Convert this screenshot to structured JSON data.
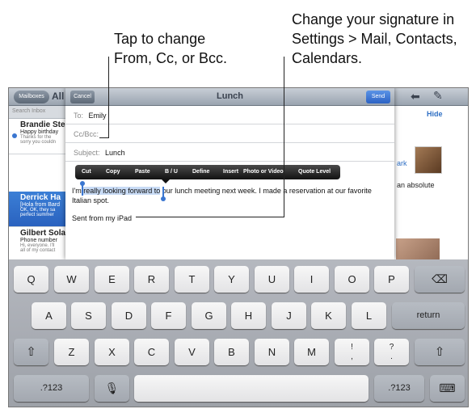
{
  "callouts": {
    "left": [
      "Tap to change",
      "From, Cc, or Bcc."
    ],
    "right": [
      "Change your signature in",
      "Settings > Mail, Contacts,",
      "Calendars."
    ]
  },
  "ipad_bar": {
    "mailboxes_label": "Mailboxes",
    "title": "All I",
    "reply_icon": "reply-arrow-icon",
    "compose_icon": "compose-icon"
  },
  "inbox": {
    "search_placeholder": "Search Inbox",
    "messages": [
      {
        "from": "Brandie Ste",
        "subject": "Happy birthday",
        "preview1": "Thanks for the",
        "preview2": "sorry you couldn"
      },
      {
        "from": "Derrick Ha",
        "subject": "[Hola from Bard",
        "preview1": "OK, OK, they sa",
        "preview2": "perfect summer"
      },
      {
        "from": "Gilbert Sola",
        "subject": "Phone number",
        "preview1": "Hi, everyone. I'll",
        "preview2": "all of my contact"
      }
    ]
  },
  "right_pane": {
    "hide_label": "Hide",
    "link_fragment": "ark",
    "text_fragment": "an absolute"
  },
  "compose": {
    "title": "Lunch",
    "cancel_label": "Cancel",
    "send_label": "Send",
    "to_label": "To:",
    "to_value": "Emily",
    "ccbcc_label": "Cc/Bcc:",
    "subject_label": "Subject:",
    "subject_value": "Lunch",
    "body_before": "I'm ",
    "body_selected": "really looking forward to",
    "body_after": " our lunch meeting next week. I made a reservation at our favorite Italian spot.",
    "signature": "Sent from my iPad"
  },
  "edit_menu": [
    "Cut",
    "Copy",
    "Paste",
    "B / U",
    "Define",
    "Insert",
    "Photo or Video",
    "Quote Level"
  ],
  "keyboard": {
    "row1": [
      "Q",
      "W",
      "E",
      "R",
      "T",
      "Y",
      "U",
      "I",
      "O",
      "P"
    ],
    "row2": [
      "A",
      "S",
      "D",
      "F",
      "G",
      "H",
      "J",
      "K",
      "L"
    ],
    "row3": [
      "Z",
      "X",
      "C",
      "V",
      "B",
      "N",
      "M"
    ],
    "excl_top": "!",
    "excl_bottom": ",",
    "quest_top": "?",
    "quest_bottom": ".",
    "return_label": "return",
    "numbers_label": ".?123",
    "delete_icon": "backspace-icon",
    "shift_icon": "shift-icon",
    "mic_icon": "microphone-icon",
    "hide_keyboard_icon": "keyboard-dismiss-icon"
  }
}
